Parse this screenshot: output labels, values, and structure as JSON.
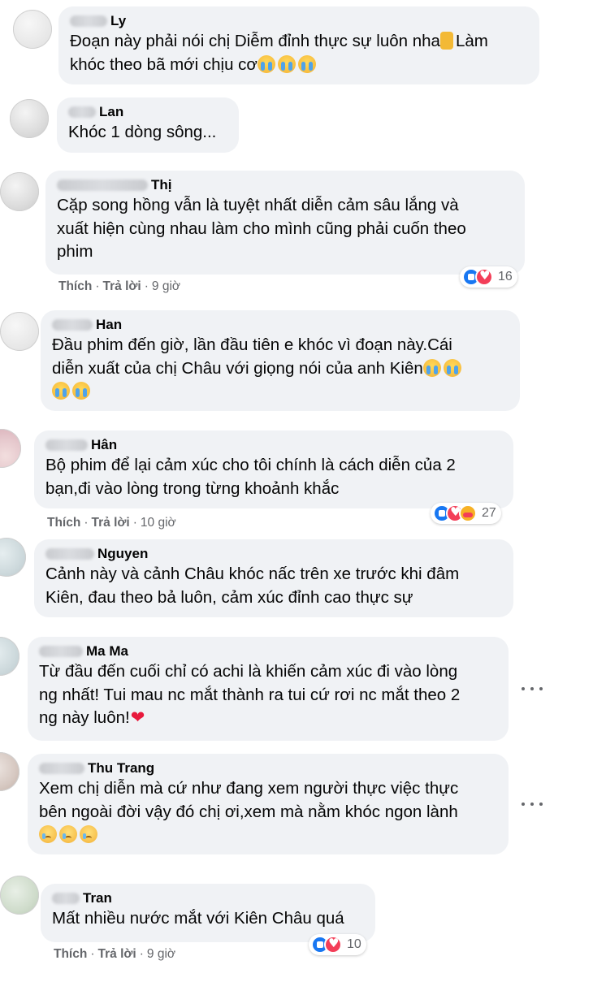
{
  "comments": [
    {
      "name": "Ly",
      "text": "Đoạn này phải nói chị Diễm đỉnh thực sự luôn nha",
      "text_tail": "Làm\nkhóc theo bã mới chịu cơ"
    },
    {
      "name": "Lan",
      "text": "Khóc 1 dòng sông..."
    },
    {
      "name": "Thị",
      "text": "Cặp song hồng vẫn là tuyệt nhất diễn cảm sâu lắng và\nxuất hiện cùng nhau làm cho mình cũng phải cuốn theo\nphim",
      "reaction_count": "16"
    },
    {
      "name": "Han",
      "text": "Đầu phim đến giờ, lần đầu tiên e khóc vì đoạn này.Cái\ndiễn xuất của chị Châu với giọng nói của anh Kiên"
    },
    {
      "name": "Hân",
      "text": "Bộ phim để lại cảm xúc cho tôi chính là cách diễn của 2\nbạn,đi vào lòng trong từng khoảnh khắc",
      "reaction_count": "27"
    },
    {
      "name": "Nguyen",
      "text": "Cảnh này và cảnh Châu khóc nấc trên xe trước khi đâm\nKiên, đau theo bả luôn, cảm xúc đỉnh cao thực sự"
    },
    {
      "name": "Ma Ma",
      "text": "Từ đầu đến cuối chỉ có achi là khiến cảm xúc đi vào lòng\nng nhất! Tui mau nc mắt thành ra tui cứ rơi nc mắt theo 2\nng này luôn!"
    },
    {
      "name": "Thu Trang",
      "text": "Xem chị diễn mà cứ như đang xem người thực việc thực\nbên ngoài đời vậy đó chị ơi,xem mà nằm khóc ngon lành"
    },
    {
      "name": "Tran",
      "text": "Mất nhiều nước mắt với Kiên Châu quá",
      "reaction_count": "10"
    }
  ],
  "actions": {
    "like": "Thích",
    "reply": "Trả lời",
    "separator": "·",
    "time_9h": "9 giờ",
    "time_10h": "10 giờ"
  }
}
